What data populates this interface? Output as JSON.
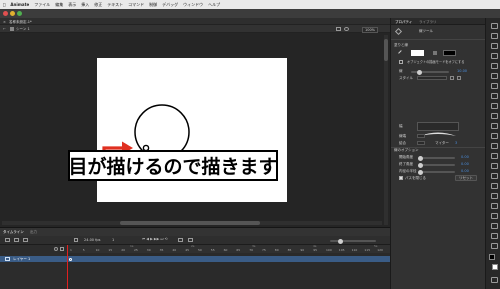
{
  "menubar": {
    "apple": "",
    "items": [
      "Animate",
      "ファイル",
      "編集",
      "表示",
      "挿入",
      "修正",
      "テキスト",
      "コマンド",
      "制御",
      "デバッグ",
      "ウィンドウ",
      "ヘルプ"
    ]
  },
  "document": {
    "tab_label": "名称未設定-1*",
    "scene_label": "シーン 1",
    "zoom": "100%"
  },
  "stage": {
    "caption": "目が描けるので描きます",
    "accent_color": "#e03020"
  },
  "properties": {
    "tabs": [
      "プロパティ",
      "ライブラリ"
    ],
    "tool_name": "線ツール",
    "section_fill_stroke": "塗りと線",
    "object_drawing": "オブジェクトの描画モードをオフにする",
    "stroke_label": "線",
    "stroke_value": "10.00",
    "style_label": "スタイル",
    "width_label": "幅",
    "cap_label": "線端",
    "join_label": "結合",
    "miter_label": "マイター",
    "miter_value": "3",
    "section_easing": "線のオプション",
    "opt1_label": "開始角度",
    "opt1_value": "0.00",
    "opt2_label": "終了角度",
    "opt2_value": "0.00",
    "opt3_label": "内径の半径",
    "opt3_value": "0.00",
    "close_path": "パスを閉じる",
    "reset": "リセット"
  },
  "timeline": {
    "title": "タイムライン",
    "output": "出力",
    "fps": "24.00 fps",
    "frame": "1",
    "layer_name": "レイヤー 1",
    "ruler_ticks": [
      "1",
      "5",
      "10",
      "15",
      "20",
      "25",
      "30",
      "35",
      "40",
      "45",
      "50",
      "55",
      "60",
      "65",
      "70",
      "75",
      "80",
      "85",
      "90",
      "95",
      "100",
      "105",
      "110",
      "115",
      "120"
    ],
    "seconds": [
      "1s",
      "2s",
      "3s",
      "4s",
      "5s"
    ]
  }
}
